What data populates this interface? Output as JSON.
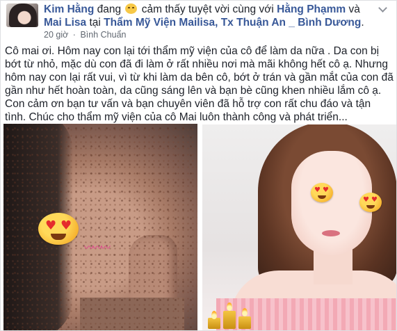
{
  "post": {
    "author": "Kim Hằng",
    "verb": "đang",
    "feeling": "cảm thấy tuyệt vời",
    "with_word": "cùng với",
    "tag1": "Hằng Phạmm",
    "and_word": "và",
    "tag2": "Mai Lisa",
    "at_word": "tại",
    "location": "Thẩm Mỹ Viện Mailisa, Tx Thuận An _ Bình Dương",
    "time": "20 giờ",
    "place": "Bình Chuẩn",
    "body": "Cô mai ơi. Hôm nay con lại tới thẩm mỹ viện của cô để làm da nữa . Da con bị bớt từ nhỏ, mặc dù con đã đi làm ở rất nhiều nơi mà mãi không hết cô ạ. Nhưng hôm nay con lại rất vui, vì từ khi làm da bên cô, bớt ở trán và gần mắt của con đã gần như hết hoàn toàn, da cũng sáng lên và bạn bè cũng khen nhiều lắm cô ạ. Con cảm ơn bạn tư vấn và bạn chuyên viên đã hỗ trợ con rất chu đáo và tận tình. Chúc cho thẩm mỹ viện của cô Mai luôn thành công và phát triển..."
  },
  "icons": {
    "feeling": "grinning-face-icon",
    "menu": "chevron-down-icon",
    "photo_left_emoji": "heart-eyes-emoji-icon",
    "photo_right_emoji": "heart-eyes-emoji-icon",
    "candles": "candles-icon",
    "lashes": "eyelash-icon"
  },
  "colors": {
    "link": "#385898",
    "text": "#1d2129",
    "meta": "#606770"
  }
}
